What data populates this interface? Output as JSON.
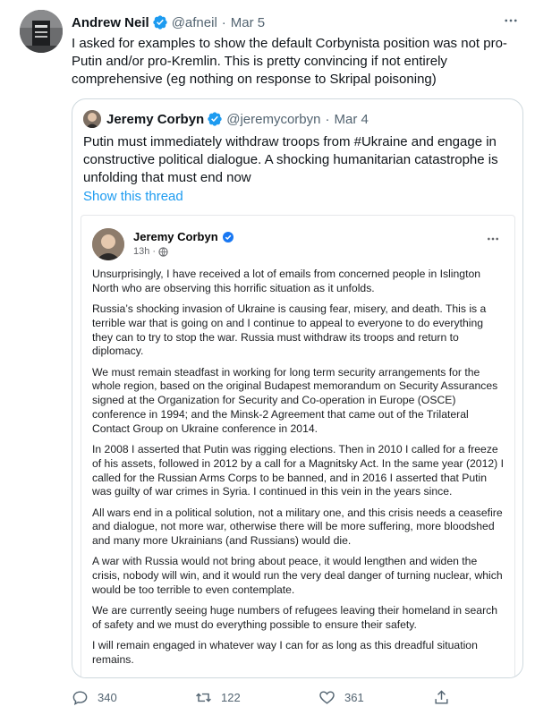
{
  "tweet": {
    "author_name": "Andrew Neil",
    "author_handle": "@afneil",
    "separator": "·",
    "date": "Mar 5",
    "text": "I asked for examples to show the default Corbynista position was not pro-Putin and/or pro-Kremlin. This is pretty convincing if not entirely comprehensive (eg nothing on response to Skripal poisoning)",
    "more_icon": "more-horizontal-icon"
  },
  "quoted_tweet": {
    "author_name": "Jeremy Corbyn",
    "author_handle": "@jeremycorbyn",
    "separator": "·",
    "date": "Mar 4",
    "text": "Putin must immediately withdraw troops from #Ukraine and engage in constructive political dialogue. A shocking humanitarian catastrophe is unfolding that must end now",
    "show_thread_label": "Show this thread"
  },
  "facebook_post": {
    "author_name": "Jeremy Corbyn",
    "time": "13h",
    "separator": "·",
    "paragraphs": [
      "Unsurprisingly, I have received a lot of emails from concerned people in Islington North who are observing this horrific situation as it unfolds.",
      "Russia’s shocking invasion of Ukraine is causing fear, misery, and death.  This is a terrible war that is going on and I continue to appeal to everyone to do everything they can to try to stop the war.   Russia must withdraw its troops and return to diplomacy.",
      "We must remain steadfast in working for long term security arrangements for the whole region, based on the original Budapest memorandum on Security Assurances signed at the Organization for Security and Co-operation in Europe (OSCE) conference in 1994; and the Minsk-2 Agreement that came out of the Trilateral Contact Group on Ukraine conference in 2014.",
      "In 2008 I asserted that Putin was rigging elections. Then in 2010 I called for a freeze of his assets, followed in 2012 by a call for a Magnitsky Act.  In the same year (2012) I called for the Russian Arms Corps to be banned, and in 2016 I asserted that Putin was guilty of war crimes in Syria.  I continued in this vein in the years since.",
      "All wars end in a political solution, not a military one, and this crisis needs a ceasefire and dialogue, not more war, otherwise there will be more suffering, more bloodshed and many more Ukrainians (and Russians) would die.",
      "A war with Russia would not bring about peace, it would lengthen and widen the crisis, nobody will win, and it would run the very deal danger of turning nuclear, which would be too terrible to even contemplate.",
      "We are currently seeing huge numbers of refugees leaving their homeland in search of safety and we must do everything possible to ensure their safety.",
      "I will remain engaged in whatever way I can for as long as this dreadful situation remains."
    ]
  },
  "actions": {
    "reply_count": "340",
    "retweet_count": "122",
    "like_count": "361"
  },
  "colors": {
    "accent": "#1d9bf0",
    "text_primary": "#0f1419",
    "text_secondary": "#536471",
    "border": "#cfd9de"
  }
}
